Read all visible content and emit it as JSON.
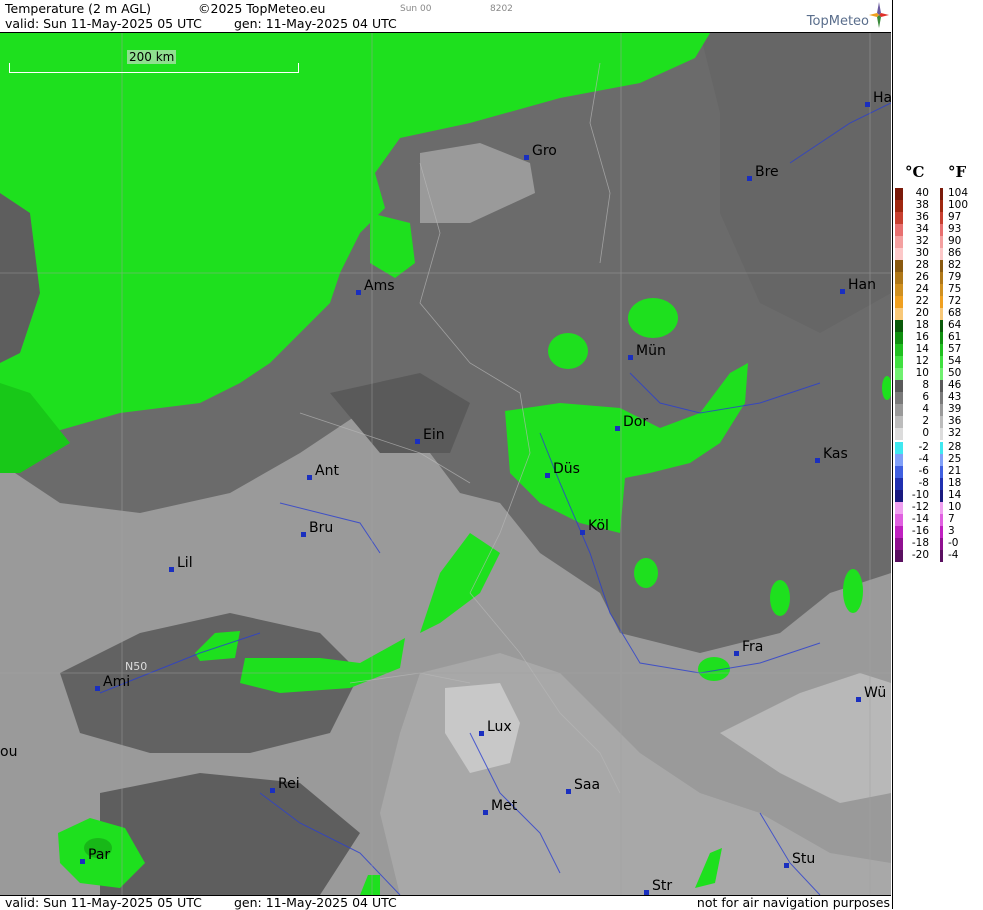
{
  "header": {
    "title": "Temperature (2 m AGL)",
    "copyright": "©2025 TopMeteo.eu",
    "run": "Sun 00",
    "code": "8202",
    "valid": "valid:  Sun  11-May-2025  05 UTC",
    "gen": "gen: 11-May-2025 04 UTC",
    "brand": "TopMeteo"
  },
  "footer": {
    "valid": "valid:  Sun  11-May-2025  05 UTC",
    "gen": "gen: 11-May-2025 04 UTC",
    "disclaimer": "not for air navigation purposes"
  },
  "scale_label": "200 km",
  "lat_label": "N50",
  "cities": [
    {
      "name": "Ha"
    },
    {
      "name": "Gro"
    },
    {
      "name": "Bre"
    },
    {
      "name": "Ams"
    },
    {
      "name": "Han"
    },
    {
      "name": "Mün"
    },
    {
      "name": "Ein"
    },
    {
      "name": "Dor"
    },
    {
      "name": "Ant"
    },
    {
      "name": "Düs"
    },
    {
      "name": "Kas"
    },
    {
      "name": "Bru"
    },
    {
      "name": "Köl"
    },
    {
      "name": "Lil"
    },
    {
      "name": "Fra"
    },
    {
      "name": "Ami"
    },
    {
      "name": "Wü"
    },
    {
      "name": "Lux"
    },
    {
      "name": "ou"
    },
    {
      "name": "Rei"
    },
    {
      "name": "Saa"
    },
    {
      "name": "Met"
    },
    {
      "name": "Par"
    },
    {
      "name": "Stu"
    },
    {
      "name": "Str"
    }
  ],
  "legend": {
    "celsius_label": "°C",
    "fahrenheit_label": "°F",
    "celsius": [
      "40",
      "38",
      "36",
      "34",
      "32",
      "30",
      "28",
      "26",
      "24",
      "22",
      "20",
      "18",
      "16",
      "14",
      "12",
      "10",
      "8",
      "6",
      "4",
      "2",
      "0",
      "-2",
      "-4",
      "-6",
      "-8",
      "-10",
      "-12",
      "-14",
      "-16",
      "-18",
      "-20"
    ],
    "fahrenheit": [
      "104",
      "100",
      "97",
      "93",
      "90",
      "86",
      "82",
      "79",
      "75",
      "72",
      "68",
      "64",
      "61",
      "57",
      "54",
      "50",
      "46",
      "43",
      "39",
      "36",
      "32",
      "28",
      "25",
      "21",
      "18",
      "14",
      "10",
      "7",
      "3",
      "-0",
      "-4"
    ],
    "colors": [
      "#7a1a0a",
      "#a02810",
      "#c84030",
      "#e87070",
      "#f4a0a0",
      "#fcc8c8",
      "#8a5a10",
      "#b07818",
      "#d09020",
      "#f0a020",
      "#f8c878",
      "#0a5a0a",
      "#109010",
      "#20c020",
      "#40e040",
      "#70f070",
      "#5a5a5a",
      "#7a7a7a",
      "#9a9a9a",
      "#bcbcbc",
      "#dcdcdc",
      "#40e8f0",
      "#80a0f8",
      "#4060e0",
      "#2030b0",
      "#1a1a80",
      "#f0a0f0",
      "#e060e0",
      "#c020c0",
      "#901090",
      "#5a1060"
    ]
  }
}
